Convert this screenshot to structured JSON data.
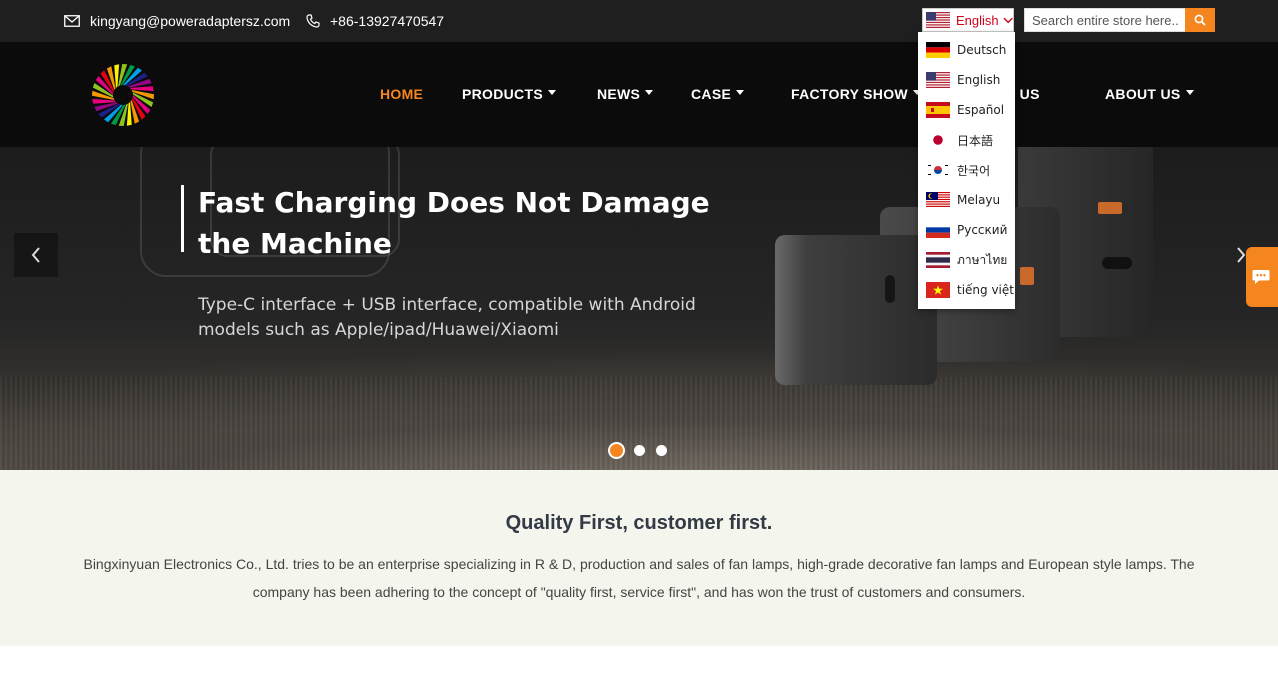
{
  "topbar": {
    "email": "kingyang@poweradaptersz.com",
    "phone": "+86-13927470547",
    "language_current": "English",
    "search_placeholder": "Search entire store here..."
  },
  "nav": {
    "items": [
      {
        "label": "HOME",
        "active": true,
        "has_caret": false
      },
      {
        "label": "PRODUCTS",
        "has_caret": true
      },
      {
        "label": "NEWS",
        "has_caret": true
      },
      {
        "label": "CASE",
        "has_caret": true
      },
      {
        "label": "FACTORY SHOW",
        "has_caret": true
      },
      {
        "label": "CONTACT US",
        "has_caret": false
      },
      {
        "label": "ABOUT US",
        "has_caret": true
      }
    ]
  },
  "languages": [
    {
      "label": "Deutsch",
      "flag": "flag-de-icon"
    },
    {
      "label": "English",
      "flag": "flag-us-icon"
    },
    {
      "label": "Español",
      "flag": "flag-es-icon"
    },
    {
      "label": "日本語",
      "flag": "flag-jp-icon"
    },
    {
      "label": "한국어",
      "flag": "flag-kr-icon"
    },
    {
      "label": "Melayu",
      "flag": "flag-my-icon"
    },
    {
      "label": "Русский",
      "flag": "flag-ru-icon"
    },
    {
      "label": "ภาษาไทย",
      "flag": "flag-th-icon"
    },
    {
      "label": "tiếng việt",
      "flag": "flag-vn-icon"
    }
  ],
  "hero": {
    "title": "Fast Charging Does Not Damage the Machine",
    "subtitle": "Type-C interface + USB interface, compatible with Android models such as Apple/ipad/Huawei/Xiaomi",
    "slide_count": 3,
    "active_slide": 1
  },
  "quality": {
    "title": "Quality First, customer first.",
    "text": "Bingxinyuan Electronics Co., Ltd. tries to be an enterprise specializing in R & D, production and sales of fan lamps, high-grade decorative fan lamps and European style lamps. The company has been adhering to the concept of \"quality first, service first\", and has won the trust of customers and consumers."
  },
  "colors": {
    "accent": "#f5861f",
    "topbar_bg": "#1f1f1f",
    "nav_bg": "#0b0b0b",
    "section_bg": "#f4f5ed",
    "language_text": "#d0021b"
  }
}
